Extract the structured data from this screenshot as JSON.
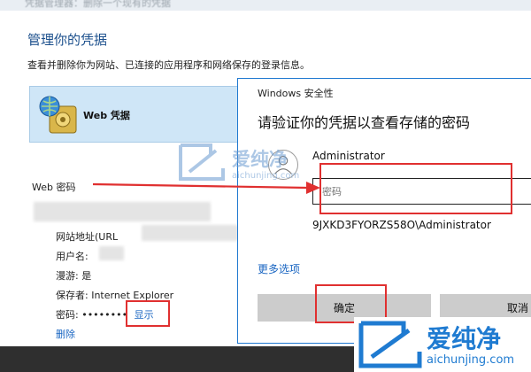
{
  "page": {
    "top_strip_text": "凭据管理器：删除一个现有的凭据",
    "title": "管理你的凭据",
    "description": "查看并删除你为网站、已连接的应用程序和网络保存的登录信息。"
  },
  "credential_tile": {
    "label": "Web 凭据"
  },
  "web_passwords": {
    "section_label": "Web 密码",
    "site_label": "网站地址(URL",
    "user_label": "用户名:",
    "roaming_label": "漫游: 是",
    "saved_by_label": "保存者: Internet Explorer",
    "password_label": "密码: ",
    "password_mask": "••••••••",
    "show_link": "显示",
    "delete_link": "删除"
  },
  "dialog": {
    "caption": "Windows 安全性",
    "heading": "请验证你的凭据以查看存储的密码",
    "username": "Administrator",
    "password_placeholder": "密码",
    "domain_user": "9JXKD3FYORZS58O\\Administrator",
    "more_options": "更多选项",
    "ok_label": "确定",
    "cancel_label": "取消"
  },
  "watermark": {
    "brand": "爱纯净",
    "url": "aichunjing.com",
    "color": "#1f7bd1"
  },
  "colors": {
    "accent": "#1a66c2",
    "annotation_red": "#e03030",
    "tile_bg": "#cfe6f7"
  }
}
